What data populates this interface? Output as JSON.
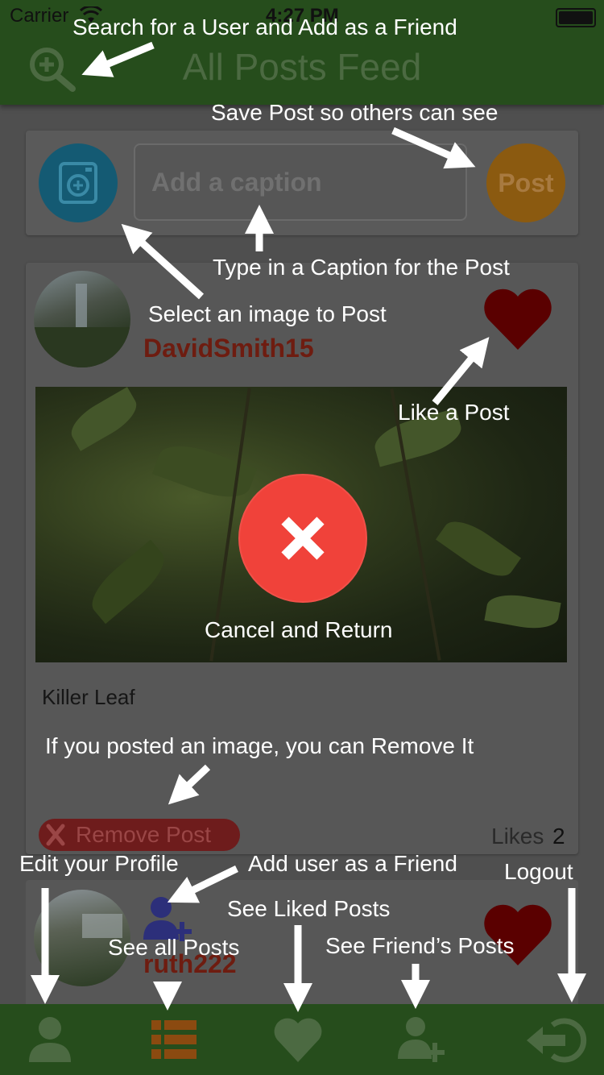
{
  "status_bar": {
    "carrier": "Carrier",
    "time": "4:27 PM"
  },
  "header": {
    "title": "All Posts Feed"
  },
  "composer": {
    "caption_placeholder": "Add a caption",
    "post_label": "Post"
  },
  "posts": [
    {
      "username": "DavidSmith15",
      "caption": "Killer Leaf",
      "remove_label": "Remove Post",
      "likes_label": "Likes",
      "likes_count": "2"
    },
    {
      "username": "ruth222"
    }
  ],
  "annotations": {
    "search": "Search for a User and Add as a Friend",
    "save_post": "Save Post so others can see",
    "type_caption": "Type in a Caption for the Post",
    "select_image": "Select an image to Post",
    "like_post": "Like a Post",
    "cancel": "Cancel and Return",
    "remove": "If you posted an image, you can Remove It",
    "edit_profile": "Edit your Profile",
    "add_friend": "Add user as a Friend",
    "logout": "Logout",
    "liked_posts": "See Liked Posts",
    "all_posts": "See all Posts",
    "friends_posts": "See Friend’s Posts"
  },
  "colors": {
    "header_bg": "#264d1c",
    "accent_red": "#f0423a",
    "heart": "#5a0000",
    "post_button": "#8b5a10",
    "image_button": "#145a73"
  },
  "icons": {
    "search": "search-plus-icon",
    "image": "camera-icon",
    "like": "heart-icon",
    "cancel": "close-icon",
    "remove": "x-icon",
    "add_friend": "user-plus-icon",
    "tab_profile": "user-icon",
    "tab_all": "list-icon",
    "tab_liked": "heart-icon",
    "tab_friends": "user-plus-icon",
    "tab_logout": "logout-icon"
  }
}
